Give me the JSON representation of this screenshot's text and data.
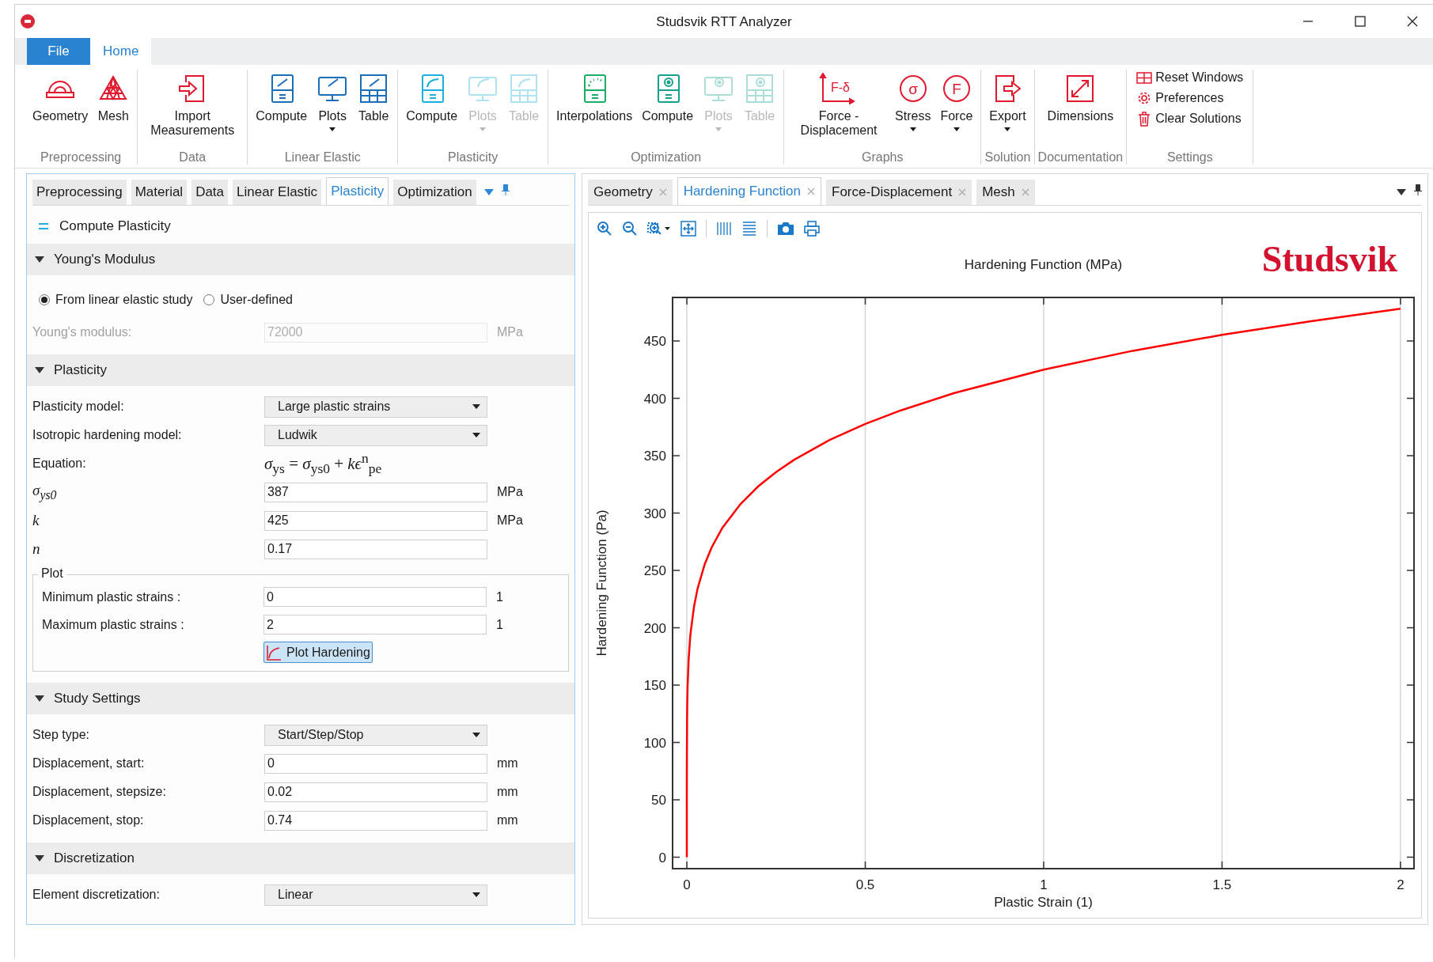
{
  "window": {
    "title": "Studsvik RTT Analyzer"
  },
  "ribbon": {
    "tabs": [
      {
        "label": "File",
        "kind": "file",
        "selected": false
      },
      {
        "label": "Home",
        "kind": "tab",
        "selected": true
      }
    ],
    "groups": [
      {
        "label": "Preprocessing",
        "kind": "large",
        "items": [
          {
            "label": "Geometry",
            "disabled": false,
            "dropdown": false
          },
          {
            "label": "Mesh",
            "disabled": false,
            "dropdown": false
          }
        ]
      },
      {
        "label": "Data",
        "kind": "large",
        "items": [
          {
            "label": "Import Measurements",
            "disabled": false,
            "dropdown": false
          }
        ]
      },
      {
        "label": "Linear Elastic",
        "kind": "large",
        "items": [
          {
            "label": "Compute",
            "disabled": false,
            "dropdown": false
          },
          {
            "label": "Plots",
            "disabled": false,
            "dropdown": true
          },
          {
            "label": "Table",
            "disabled": false,
            "dropdown": false
          }
        ]
      },
      {
        "label": "Plasticity",
        "kind": "large",
        "items": [
          {
            "label": "Compute",
            "disabled": false,
            "dropdown": false
          },
          {
            "label": "Plots",
            "disabled": true,
            "dropdown": true
          },
          {
            "label": "Table",
            "disabled": true,
            "dropdown": false
          }
        ]
      },
      {
        "label": "Optimization",
        "kind": "large",
        "items": [
          {
            "label": "Interpolations",
            "disabled": false,
            "dropdown": false
          },
          {
            "label": "Compute",
            "disabled": false,
            "dropdown": false
          },
          {
            "label": "Plots",
            "disabled": true,
            "dropdown": true
          },
          {
            "label": "Table",
            "disabled": true,
            "dropdown": false
          }
        ]
      },
      {
        "label": "Graphs",
        "kind": "large",
        "items": [
          {
            "label": "Force - Displacement",
            "glyph": "F-δ",
            "disabled": false,
            "dropdown": false
          },
          {
            "label": "Stress",
            "glyph": "σ",
            "disabled": false,
            "dropdown": true
          },
          {
            "label": "Force",
            "glyph": "F",
            "disabled": false,
            "dropdown": true
          }
        ]
      },
      {
        "label": "Solution",
        "kind": "large",
        "items": [
          {
            "label": "Export",
            "disabled": false,
            "dropdown": true
          }
        ]
      },
      {
        "label": "Documentation",
        "kind": "large",
        "items": [
          {
            "label": "Dimensions",
            "disabled": false,
            "dropdown": false
          }
        ]
      },
      {
        "label": "Settings",
        "kind": "small",
        "items": [
          {
            "label": "Reset Windows",
            "disabled": false,
            "dropdown": false
          },
          {
            "label": "Preferences",
            "disabled": false,
            "dropdown": false
          },
          {
            "label": "Clear Solutions",
            "disabled": false,
            "dropdown": false
          }
        ]
      }
    ]
  },
  "left_panel": {
    "tabs": [
      {
        "label": "Preprocessing",
        "selected": false
      },
      {
        "label": "Material",
        "selected": false
      },
      {
        "label": "Data",
        "selected": false
      },
      {
        "label": "Linear Elastic",
        "selected": false
      },
      {
        "label": "Plasticity",
        "selected": true
      },
      {
        "label": "Optimization",
        "selected": false
      }
    ],
    "command": "Compute Plasticity",
    "sections": [
      {
        "title": "Young's Modulus",
        "expanded": true,
        "rows": [
          {
            "kind": "radio",
            "options": [
              {
                "label": "From linear elastic study",
                "selected": true
              },
              {
                "label": "User-defined",
                "selected": false
              }
            ]
          },
          {
            "kind": "field",
            "label": "Young's modulus:",
            "value": "72000",
            "unit": "MPa",
            "disabled": true,
            "italic": false
          }
        ]
      },
      {
        "title": "Plasticity",
        "expanded": true,
        "rows": [
          {
            "kind": "select",
            "label": "Plasticity model:",
            "value": "Large plastic strains"
          },
          {
            "kind": "select",
            "label": "Isotropic hardening model:",
            "value": "Ludwik"
          },
          {
            "kind": "equation",
            "label": "Equation:",
            "value": "*σ*$_{ys}$ = *σ*$_{ys0}$ + *kϵ*$^{n}$$_{pe}$"
          },
          {
            "kind": "field",
            "label": "σ$_{ys0}$",
            "value": "387",
            "unit": "MPa",
            "disabled": false,
            "italic": true
          },
          {
            "kind": "field",
            "label": "k",
            "value": "425",
            "unit": "MPa",
            "disabled": false,
            "italic": true
          },
          {
            "kind": "field",
            "label": "n",
            "value": "0.17",
            "disabled": false,
            "italic": true
          },
          {
            "kind": "group",
            "title": "Plot",
            "rows": [
              {
                "kind": "field",
                "label": "Minimum plastic strains :",
                "value": "0",
                "unit": "1",
                "disabled": false,
                "italic": false
              },
              {
                "kind": "field",
                "label": "Maximum plastic strains :",
                "value": "2",
                "unit": "1",
                "disabled": false,
                "italic": false
              },
              {
                "kind": "button",
                "label": "Plot Hardening"
              }
            ]
          }
        ]
      },
      {
        "title": "Study Settings",
        "expanded": true,
        "rows": [
          {
            "kind": "select",
            "label": "Step type:",
            "value": "Start/Step/Stop"
          },
          {
            "kind": "field",
            "label": "Displacement, start:",
            "value": "0",
            "unit": "mm",
            "disabled": false,
            "italic": false
          },
          {
            "kind": "field",
            "label": "Displacement, stepsize:",
            "value": "0.02",
            "unit": "mm",
            "disabled": false,
            "italic": false
          },
          {
            "kind": "field",
            "label": "Displacement, stop:",
            "value": "0.74",
            "unit": "mm",
            "disabled": false,
            "italic": false
          }
        ]
      },
      {
        "title": "Discretization",
        "expanded": true,
        "rows": [
          {
            "kind": "select",
            "label": "Element discretization:",
            "value": "Linear"
          }
        ]
      }
    ]
  },
  "right_panel": {
    "tabs": [
      {
        "label": "Geometry",
        "selected": false
      },
      {
        "label": "Hardening Function",
        "selected": true
      },
      {
        "label": "Force-Displacement",
        "selected": false
      },
      {
        "label": "Mesh",
        "selected": false
      }
    ],
    "logo": "Studsvik",
    "chart_data": {
      "type": "line",
      "title": "Hardening Function (MPa)",
      "xlabel": "Plastic Strain (1)",
      "ylabel": "Hardening Function (Pa)",
      "x": [
        0,
        1e-05,
        0.0001,
        0.0005,
        0.001,
        0.002,
        0.005,
        0.01,
        0.02,
        0.03,
        0.05,
        0.07,
        0.1,
        0.15,
        0.2,
        0.25,
        0.3,
        0.4,
        0.5,
        0.6,
        0.75,
        1,
        1.25,
        1.5,
        1.75,
        2
      ],
      "series": [
        {
          "color": "#ff0000",
          "values": [
            0,
            60.1,
            88.8,
            116.7,
            131.3,
            147.7,
            172.7,
            194.2,
            218.5,
            234.2,
            255.4,
            270.4,
            287.3,
            307.8,
            323.3,
            335.7,
            346.3,
            363.7,
            377.8,
            389.6,
            404.7,
            425,
            441.5,
            455.4,
            467.4,
            478.2
          ]
        }
      ],
      "grid": true,
      "xlim": [
        -0.04,
        2.038
      ],
      "ylim": [
        -10,
        488
      ],
      "xticks": [
        0,
        0.5,
        1,
        1.5,
        2
      ],
      "yticks": [
        0,
        50,
        100,
        150,
        200,
        250,
        300,
        350,
        400,
        450
      ]
    }
  }
}
